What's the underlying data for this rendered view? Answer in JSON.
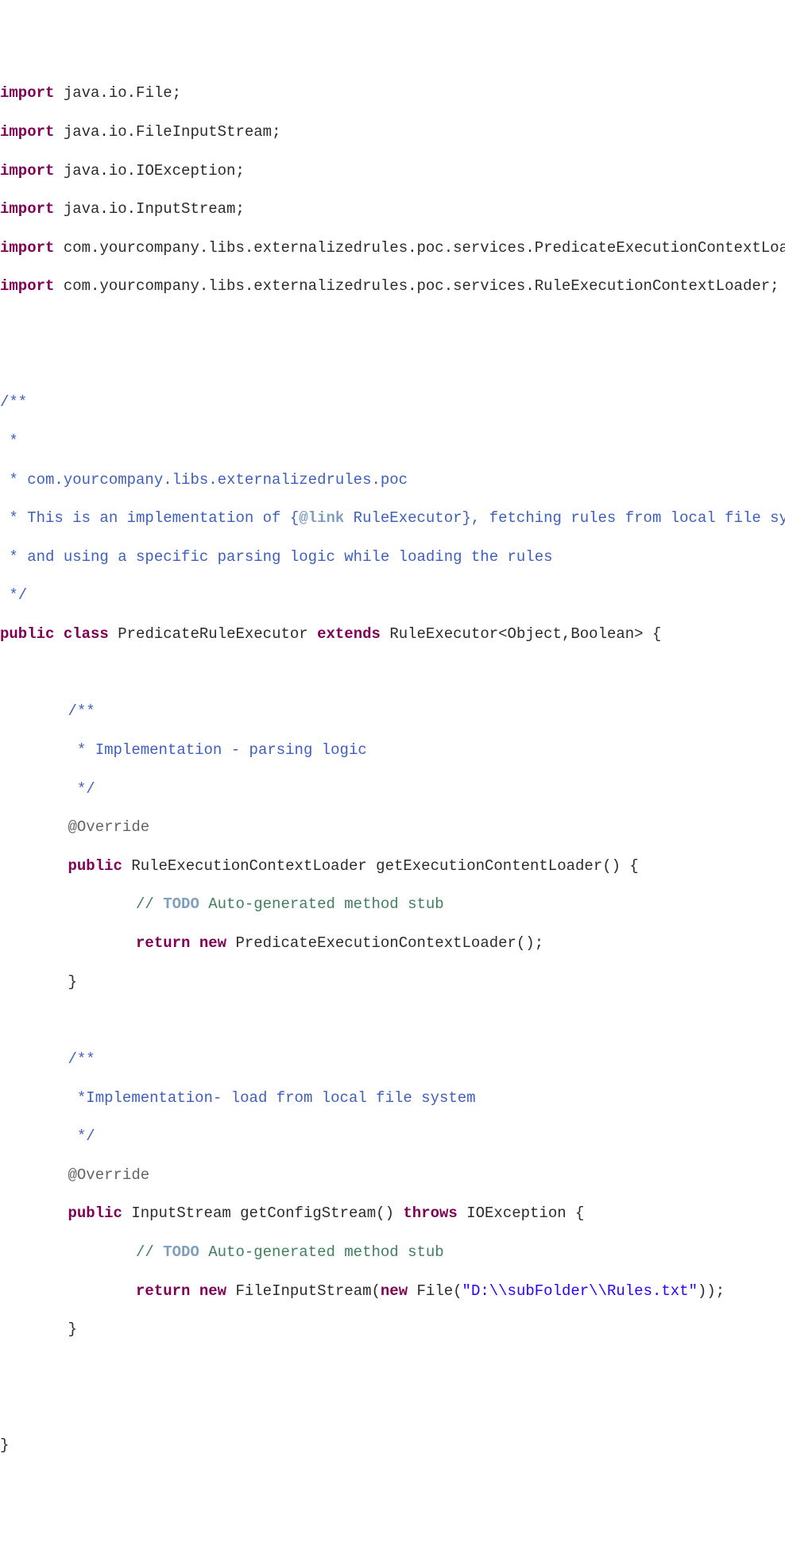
{
  "imports": {
    "kw": "import",
    "i1": " java.io.File;",
    "i2": " java.io.FileInputStream;",
    "i3": " java.io.IOException;",
    "i4": " java.io.InputStream;",
    "i5": " com.yourcompany.libs.externalizedrules.poc.services.PredicateExecutionContextLoader;",
    "i6": " com.yourcompany.libs.externalizedrules.poc.services.RuleExecutionContextLoader;"
  },
  "classdoc": {
    "d1": "/**",
    "d2": " *",
    "d3": " * com.yourcompany.libs.externalizedrules.poc",
    "d4a": " * This is an implementation of {",
    "d4tag": "@link",
    "d4b": " RuleExecutor}, fetching rules from local file system",
    "d5": " * and using a specific parsing logic while loading the rules",
    "d6": " */"
  },
  "classline": {
    "kw_public": "public",
    "sp1": " ",
    "kw_class": "class",
    "name": " PredicateRuleExecutor ",
    "kw_extends": "extends",
    "rest": " RuleExecutor<Object,Boolean> {"
  },
  "m1": {
    "d1": "/**",
    "d2": " * Implementation - parsing logic",
    "d3": " */",
    "ann": "@Override",
    "sig_a": "public",
    "sig_b": " RuleExecutionContextLoader getExecutionContentLoader() {",
    "todo_a": "// ",
    "todo_kw": "TODO",
    "todo_b": " Auto-generated method stub",
    "ret_a": "return",
    "ret_b": " ",
    "ret_c": "new",
    "ret_d": " PredicateExecutionContextLoader();",
    "close": "}"
  },
  "m2": {
    "d1": "/**",
    "d2": " *Implementation- load from local file system",
    "d3": " */",
    "ann": "@Override",
    "sig_a": "public",
    "sig_b": " InputStream getConfigStream() ",
    "sig_c": "throws",
    "sig_d": " IOException {",
    "todo_a": "// ",
    "todo_kw": "TODO",
    "todo_b": " Auto-generated method stub",
    "ret_a": "return",
    "ret_b": " ",
    "ret_c": "new",
    "ret_d": " FileInputStream(",
    "ret_e": "new",
    "ret_f": " File(",
    "str": "\"D:\\\\subFolder\\\\Rules.txt\"",
    "ret_g": "));",
    "close": "}"
  },
  "close": "}"
}
